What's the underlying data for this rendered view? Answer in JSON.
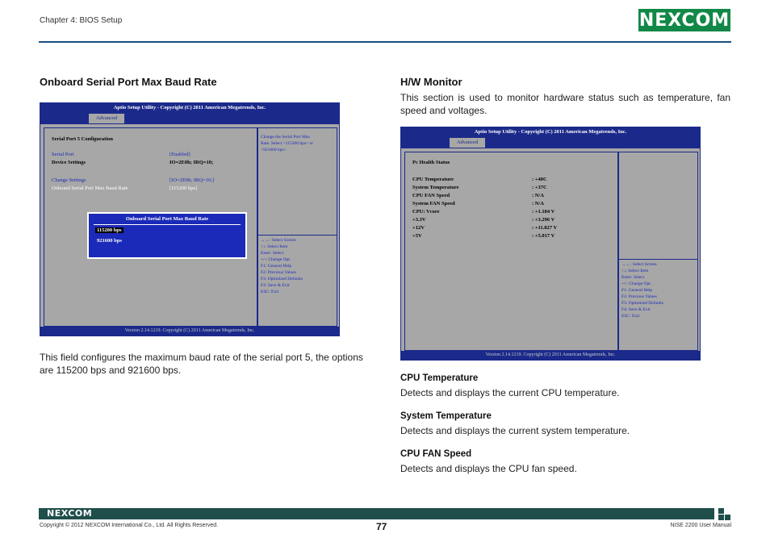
{
  "header": {
    "chapter": "Chapter 4: BIOS Setup",
    "logo": "NEXCOM"
  },
  "left": {
    "heading": "Onboard Serial Port Max Baud Rate",
    "description": "This field configures the maximum baud rate of the serial port 5, the options are 115200 bps and 921600 bps.",
    "bios": {
      "title": "Aptio Setup Utility - Copyright (C) 2011 American Megatrends, Inc.",
      "tab": "Advanced",
      "section": "Serial Port 5 Configuration",
      "rows": [
        {
          "label": "Serial Port",
          "value": "[Enabled]"
        },
        {
          "label": "Device Settings",
          "value": "IO=2E0h; IRQ=10;"
        },
        {
          "label": "Change Settings",
          "value": "[IO=2E0h; IRQ=10;]"
        },
        {
          "label": "Onboard Serial Port Max Baud Rate",
          "value": "[115200 bps]"
        }
      ],
      "help_text": [
        "Change the Serial Port Max",
        "Rate. Select <115200 bps> or",
        "<921600 bps>"
      ],
      "popup": {
        "title": "Onboard Serial Port Max Baud Rate",
        "options": [
          "115200 bps",
          "921600 bps"
        ]
      },
      "keys": [
        "→←: Select Screen",
        "↑↓: Select Item",
        "Enter: Select",
        "+/-: Change Opt.",
        "F1: General Help",
        "F2: Previous Values",
        "F3: Optimized Defaults",
        "F4: Save & Exit",
        "ESC: Exit"
      ],
      "footer": "Version 2.14.1219. Copyright (C) 2011 American Megatrends, Inc."
    }
  },
  "right": {
    "heading": "H/W Monitor",
    "intro": "This section is used to monitor hardware status such as temperature, fan speed and voltages.",
    "bios": {
      "title": "Aptio Setup Utility - Copyright (C) 2011 American Megatrends, Inc.",
      "tab": "Advanced",
      "section": "Pc Health Status",
      "rows": [
        {
          "label": "CPU Temperature",
          "value": ":  +40C"
        },
        {
          "label": "System Temperature",
          "value": ":  +37C"
        },
        {
          "label": "CPU FAN Speed",
          "value": ":  N/A"
        },
        {
          "label": "System FAN Speed",
          "value": ":  N/A"
        },
        {
          "label": "CPU: Vcore",
          "value": ":  +1.184 V"
        },
        {
          "label": "+3.3V",
          "value": ":  +3.296 V"
        },
        {
          "label": "+12V",
          "value": ":  +11.827 V"
        },
        {
          "label": "+5V",
          "value": ":  +5.017 V"
        }
      ],
      "keys": [
        "→←: Select Screen",
        "↑↓: Select Item",
        "Enter: Select",
        "+/-: Change Opt.",
        "F1: General Help",
        "F2: Previous Values",
        "F3: Optimized Defaults",
        "F4: Save & Exit",
        "ESC: Exit"
      ],
      "footer": "Version 2.14.1219. Copyright (C) 2011 American Megatrends, Inc."
    },
    "items": [
      {
        "title": "CPU Temperature",
        "text": "Detects and displays the current CPU temperature."
      },
      {
        "title": "System Temperature",
        "text": "Detects and displays the current system temperature."
      },
      {
        "title": "CPU FAN Speed",
        "text": "Detects and displays the CPU fan speed."
      }
    ]
  },
  "footer": {
    "logo": "NEXCOM",
    "copyright": "Copyright © 2012 NEXCOM International Co., Ltd. All Rights Reserved.",
    "page": "77",
    "manual": "NISE 2200 User Manual"
  }
}
